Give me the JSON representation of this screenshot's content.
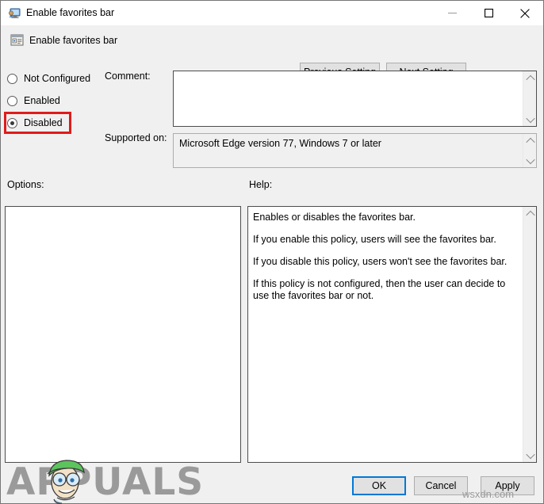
{
  "window": {
    "title": "Enable favorites bar",
    "titlebar_icon": "monitor-policy-icon",
    "minimize_icon": "minimize-icon",
    "maximize_icon": "maximize-icon",
    "close_icon": "close-icon"
  },
  "header": {
    "icon": "policy-setting-icon",
    "title": "Enable favorites bar",
    "previous_setting_label": "Previous Setting",
    "next_setting_label": "Next Setting"
  },
  "state_options": [
    {
      "label": "Not Configured",
      "selected": false
    },
    {
      "label": "Enabled",
      "selected": false
    },
    {
      "label": "Disabled",
      "selected": true
    }
  ],
  "fields": {
    "comment_label": "Comment:",
    "comment_value": "",
    "supported_on_label": "Supported on:",
    "supported_on_value": "Microsoft Edge version 77, Windows 7 or later"
  },
  "panels": {
    "options_label": "Options:",
    "options_value": "",
    "help_label": "Help:",
    "help_paragraphs": [
      "Enables or disables the favorites bar.",
      "If you enable this policy, users will see the favorites bar.",
      "If you disable this policy, users won't see the favorites bar.",
      "If this policy is not configured, then the user can decide to use the favorites bar or not."
    ]
  },
  "footer": {
    "ok_label": "OK",
    "cancel_label": "Cancel",
    "apply_label": "Apply"
  },
  "annotations": {
    "highlight_color": "#e01b1b",
    "focus_color": "#0078d7"
  },
  "watermarks": {
    "brand": "APPUALS",
    "site": "wsxdn.com"
  }
}
